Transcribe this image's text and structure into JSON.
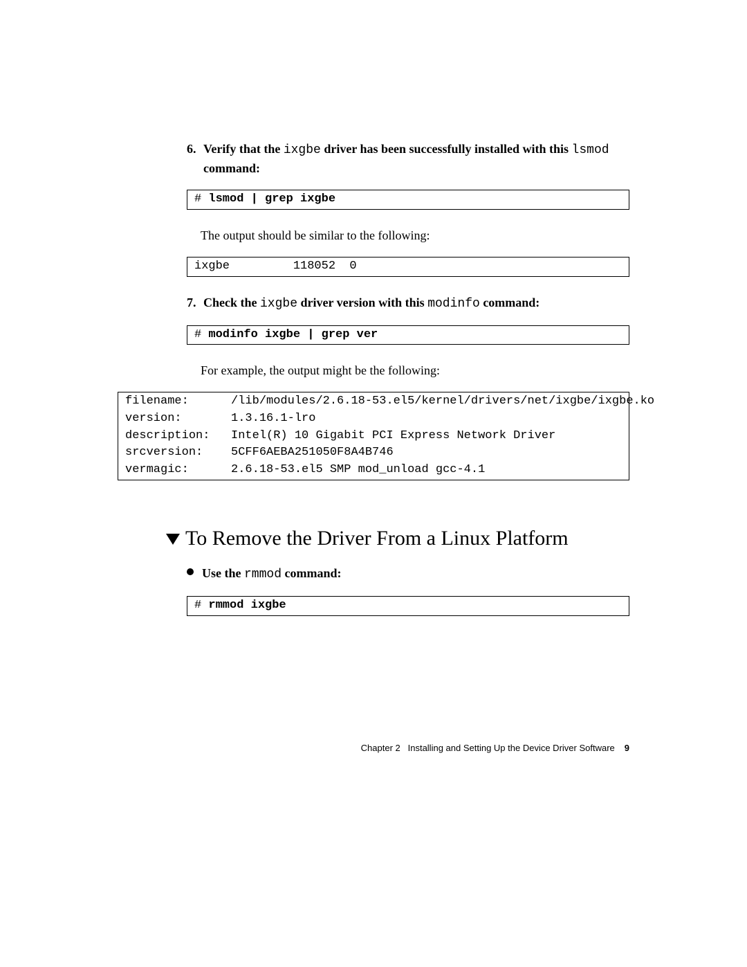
{
  "steps": {
    "6": {
      "pre": "Verify that the ",
      "driver": "ixgbe",
      "mid": " driver has been successfully installed with this ",
      "cmd": "lsmod",
      "post": " command:"
    },
    "7": {
      "pre": "Check the ",
      "driver": "ixgbe",
      "mid": " driver version with this ",
      "cmd": "modinfo",
      "post": " command:"
    }
  },
  "code": {
    "lsmod": {
      "prompt": "# ",
      "command": "lsmod | grep ixgbe"
    },
    "lsmod_output": "ixgbe         118052  0",
    "modinfo": {
      "prompt": "# ",
      "command": "modinfo ixgbe | grep ver"
    },
    "modinfo_output": "filename:      /lib/modules/2.6.18-53.el5/kernel/drivers/net/ixgbe/ixgbe.ko\nversion:       1.3.16.1-lro\ndescription:   Intel(R) 10 Gigabit PCI Express Network Driver\nsrcversion:    5CFF6AEBA251050F8A4B746\nvermagic:      2.6.18-53.el5 SMP mod_unload gcc-4.1",
    "rmmod": {
      "prompt": "# ",
      "command": "rmmod ixgbe"
    }
  },
  "body": {
    "after_lsmod": "The output should be similar to the following:",
    "after_modinfo": "For example, the output might be the following:"
  },
  "section_heading": "To Remove the Driver From a Linux Platform",
  "bullet": {
    "pre": "Use the ",
    "cmd": "rmmod",
    "post": " command:"
  },
  "footer": {
    "chapter": "Chapter 2",
    "title": "Installing and Setting Up the Device Driver Software",
    "page": "9"
  }
}
